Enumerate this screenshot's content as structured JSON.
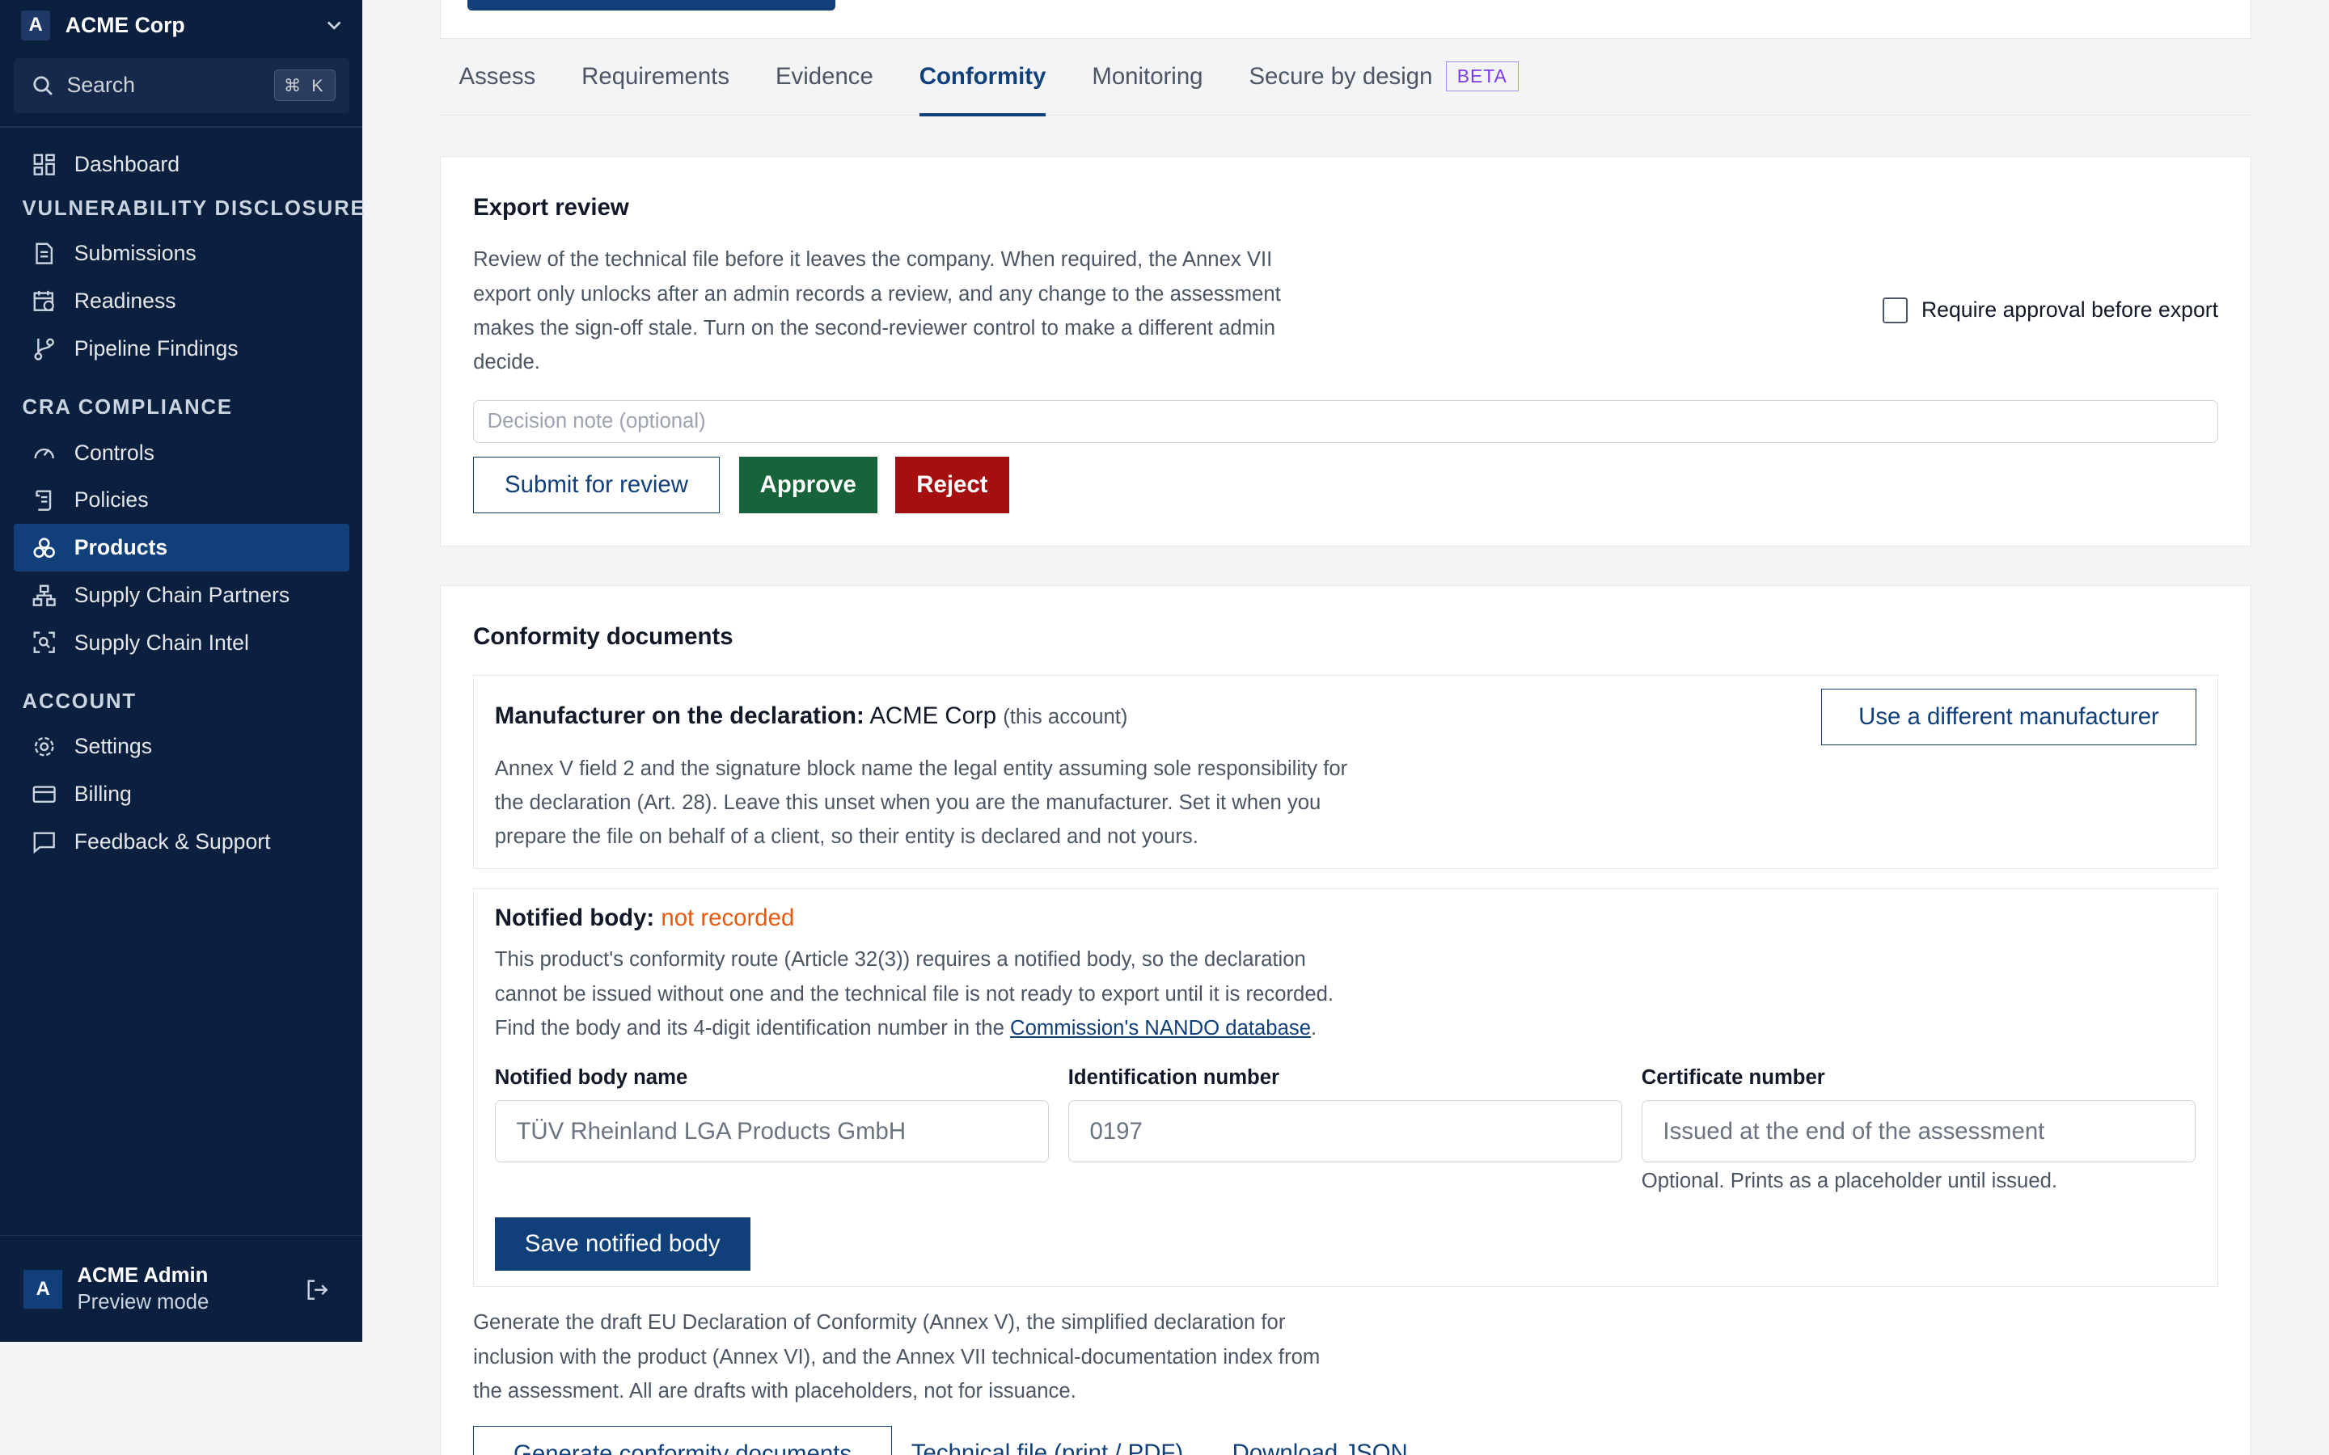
{
  "sidebar": {
    "org_initial": "A",
    "org_name": "ACME Corp",
    "search_placeholder": "Search",
    "search_shortcut": "⌘ K",
    "dashboard": "Dashboard",
    "section_vuln": "VULNERABILITY DISCLOSURE",
    "submissions": "Submissions",
    "readiness": "Readiness",
    "pipeline_findings": "Pipeline Findings",
    "section_cra": "CRA COMPLIANCE",
    "controls": "Controls",
    "policies": "Policies",
    "products": "Products",
    "supply_chain_partners": "Supply Chain Partners",
    "supply_chain_intel": "Supply Chain Intel",
    "section_account": "ACCOUNT",
    "settings": "Settings",
    "billing": "Billing",
    "feedback": "Feedback & Support",
    "user_initial": "A",
    "user_name": "ACME Admin",
    "user_mode": "Preview mode"
  },
  "tabs": {
    "assess": "Assess",
    "requirements": "Requirements",
    "evidence": "Evidence",
    "conformity": "Conformity",
    "monitoring": "Monitoring",
    "secure_by_design": "Secure by design",
    "beta": "BETA"
  },
  "export_review": {
    "title": "Export review",
    "description_1": "Review of the technical file before it leaves the company. When required, the Annex VII",
    "description_2": "export only unlocks after an admin records a review, and any change to the assessment",
    "description_3": "makes the sign-off stale. Turn on the second-reviewer control to make a different admin",
    "description_4": "decide.",
    "require_approval_label": "Require approval before export",
    "note_placeholder": "Decision note (optional)",
    "submit_label": "Submit for review",
    "approve_label": "Approve",
    "reject_label": "Reject"
  },
  "conformity": {
    "title": "Conformity documents",
    "manufacturer_label": "Manufacturer on the declaration:",
    "manufacturer_value": "ACME Corp",
    "manufacturer_note": "(this account)",
    "use_different_label": "Use a different manufacturer",
    "manufacturer_desc_1": "Annex V field 2 and the signature block name the legal entity assuming sole responsibility for",
    "manufacturer_desc_2": "the declaration (Art. 28). Leave this unset when you are the manufacturer. Set it when you",
    "manufacturer_desc_3": "prepare the file on behalf of a client, so their entity is declared and not yours.",
    "notified_body_label": "Notified body:",
    "notified_body_status": "not recorded",
    "nb_desc_1": "This product's conformity route (Article 32(3)) requires a notified body, so the declaration",
    "nb_desc_2": "cannot be issued without one and the technical file is not ready to export until it is recorded.",
    "nb_desc_3_prefix": "Find the body and its 4-digit identification number in the ",
    "nb_desc_3_link": "Commission's NANDO database",
    "nb_desc_3_suffix": ".",
    "nb_name_label": "Notified body name",
    "nb_name_placeholder": "TÜV Rheinland LGA Products GmbH",
    "nb_id_label": "Identification number",
    "nb_id_placeholder": "0197",
    "nb_cert_label": "Certificate number",
    "nb_cert_placeholder": "Issued at the end of the assessment",
    "nb_cert_hint": "Optional. Prints as a placeholder until issued.",
    "save_nb_label": "Save notified body",
    "generate_desc_1": "Generate the draft EU Declaration of Conformity (Annex V), the simplified declaration for",
    "generate_desc_2": "inclusion with the product (Annex VI), and the Annex VII technical-documentation index from",
    "generate_desc_3": "the assessment. All are drafts with placeholders, not for issuance.",
    "generate_label": "Generate conformity documents",
    "technical_file_label": "Technical file (print / PDF)",
    "download_json_label": "Download JSON"
  }
}
